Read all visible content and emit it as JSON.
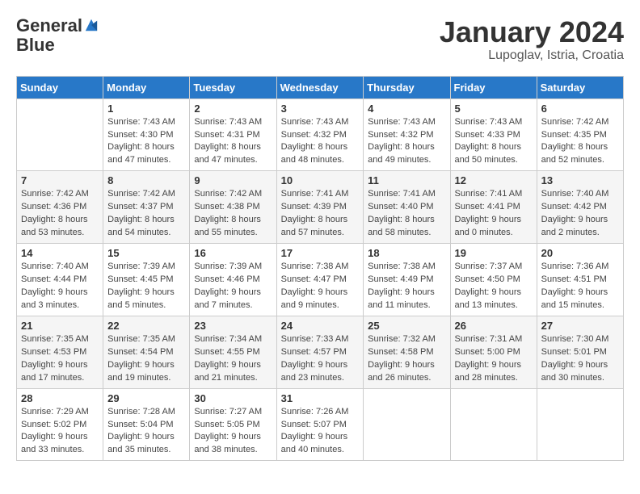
{
  "header": {
    "logo_line1": "General",
    "logo_line2": "Blue",
    "title": "January 2024",
    "subtitle": "Lupoglav, Istria, Croatia"
  },
  "days_of_week": [
    "Sunday",
    "Monday",
    "Tuesday",
    "Wednesday",
    "Thursday",
    "Friday",
    "Saturday"
  ],
  "weeks": [
    [
      {
        "day": "",
        "info": ""
      },
      {
        "day": "1",
        "info": "Sunrise: 7:43 AM\nSunset: 4:30 PM\nDaylight: 8 hours\nand 47 minutes."
      },
      {
        "day": "2",
        "info": "Sunrise: 7:43 AM\nSunset: 4:31 PM\nDaylight: 8 hours\nand 47 minutes."
      },
      {
        "day": "3",
        "info": "Sunrise: 7:43 AM\nSunset: 4:32 PM\nDaylight: 8 hours\nand 48 minutes."
      },
      {
        "day": "4",
        "info": "Sunrise: 7:43 AM\nSunset: 4:32 PM\nDaylight: 8 hours\nand 49 minutes."
      },
      {
        "day": "5",
        "info": "Sunrise: 7:43 AM\nSunset: 4:33 PM\nDaylight: 8 hours\nand 50 minutes."
      },
      {
        "day": "6",
        "info": "Sunrise: 7:42 AM\nSunset: 4:35 PM\nDaylight: 8 hours\nand 52 minutes."
      }
    ],
    [
      {
        "day": "7",
        "info": "Sunrise: 7:42 AM\nSunset: 4:36 PM\nDaylight: 8 hours\nand 53 minutes."
      },
      {
        "day": "8",
        "info": "Sunrise: 7:42 AM\nSunset: 4:37 PM\nDaylight: 8 hours\nand 54 minutes."
      },
      {
        "day": "9",
        "info": "Sunrise: 7:42 AM\nSunset: 4:38 PM\nDaylight: 8 hours\nand 55 minutes."
      },
      {
        "day": "10",
        "info": "Sunrise: 7:41 AM\nSunset: 4:39 PM\nDaylight: 8 hours\nand 57 minutes."
      },
      {
        "day": "11",
        "info": "Sunrise: 7:41 AM\nSunset: 4:40 PM\nDaylight: 8 hours\nand 58 minutes."
      },
      {
        "day": "12",
        "info": "Sunrise: 7:41 AM\nSunset: 4:41 PM\nDaylight: 9 hours\nand 0 minutes."
      },
      {
        "day": "13",
        "info": "Sunrise: 7:40 AM\nSunset: 4:42 PM\nDaylight: 9 hours\nand 2 minutes."
      }
    ],
    [
      {
        "day": "14",
        "info": "Sunrise: 7:40 AM\nSunset: 4:44 PM\nDaylight: 9 hours\nand 3 minutes."
      },
      {
        "day": "15",
        "info": "Sunrise: 7:39 AM\nSunset: 4:45 PM\nDaylight: 9 hours\nand 5 minutes."
      },
      {
        "day": "16",
        "info": "Sunrise: 7:39 AM\nSunset: 4:46 PM\nDaylight: 9 hours\nand 7 minutes."
      },
      {
        "day": "17",
        "info": "Sunrise: 7:38 AM\nSunset: 4:47 PM\nDaylight: 9 hours\nand 9 minutes."
      },
      {
        "day": "18",
        "info": "Sunrise: 7:38 AM\nSunset: 4:49 PM\nDaylight: 9 hours\nand 11 minutes."
      },
      {
        "day": "19",
        "info": "Sunrise: 7:37 AM\nSunset: 4:50 PM\nDaylight: 9 hours\nand 13 minutes."
      },
      {
        "day": "20",
        "info": "Sunrise: 7:36 AM\nSunset: 4:51 PM\nDaylight: 9 hours\nand 15 minutes."
      }
    ],
    [
      {
        "day": "21",
        "info": "Sunrise: 7:35 AM\nSunset: 4:53 PM\nDaylight: 9 hours\nand 17 minutes."
      },
      {
        "day": "22",
        "info": "Sunrise: 7:35 AM\nSunset: 4:54 PM\nDaylight: 9 hours\nand 19 minutes."
      },
      {
        "day": "23",
        "info": "Sunrise: 7:34 AM\nSunset: 4:55 PM\nDaylight: 9 hours\nand 21 minutes."
      },
      {
        "day": "24",
        "info": "Sunrise: 7:33 AM\nSunset: 4:57 PM\nDaylight: 9 hours\nand 23 minutes."
      },
      {
        "day": "25",
        "info": "Sunrise: 7:32 AM\nSunset: 4:58 PM\nDaylight: 9 hours\nand 26 minutes."
      },
      {
        "day": "26",
        "info": "Sunrise: 7:31 AM\nSunset: 5:00 PM\nDaylight: 9 hours\nand 28 minutes."
      },
      {
        "day": "27",
        "info": "Sunrise: 7:30 AM\nSunset: 5:01 PM\nDaylight: 9 hours\nand 30 minutes."
      }
    ],
    [
      {
        "day": "28",
        "info": "Sunrise: 7:29 AM\nSunset: 5:02 PM\nDaylight: 9 hours\nand 33 minutes."
      },
      {
        "day": "29",
        "info": "Sunrise: 7:28 AM\nSunset: 5:04 PM\nDaylight: 9 hours\nand 35 minutes."
      },
      {
        "day": "30",
        "info": "Sunrise: 7:27 AM\nSunset: 5:05 PM\nDaylight: 9 hours\nand 38 minutes."
      },
      {
        "day": "31",
        "info": "Sunrise: 7:26 AM\nSunset: 5:07 PM\nDaylight: 9 hours\nand 40 minutes."
      },
      {
        "day": "",
        "info": ""
      },
      {
        "day": "",
        "info": ""
      },
      {
        "day": "",
        "info": ""
      }
    ]
  ]
}
